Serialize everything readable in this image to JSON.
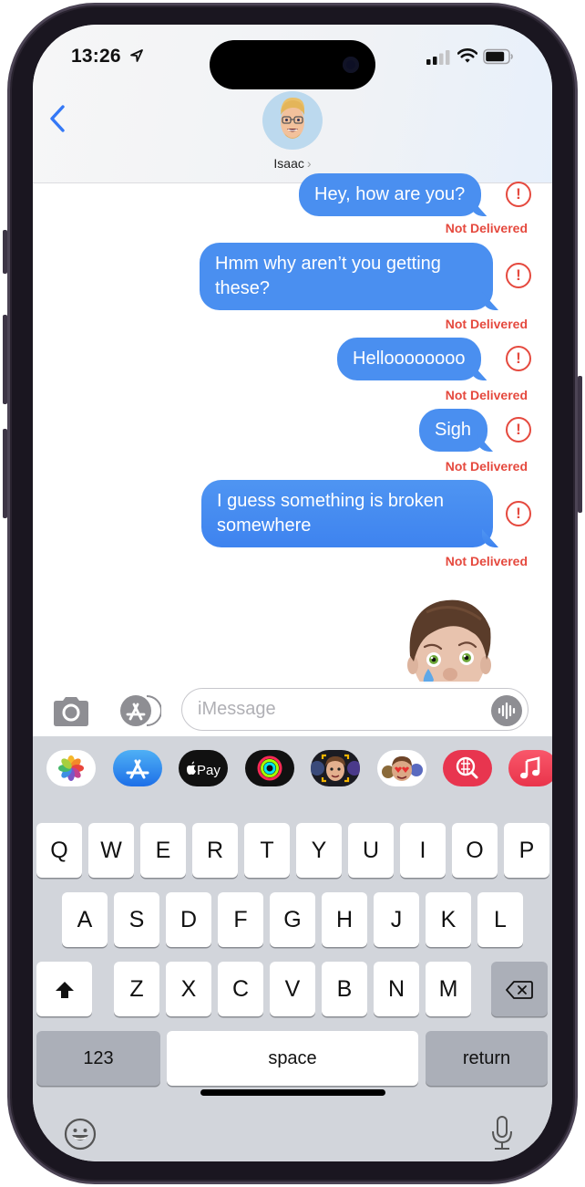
{
  "status_bar": {
    "time": "13:26",
    "location_icon": "location-arrow-icon",
    "signal_icon": "cellular-signal-icon",
    "wifi_icon": "wifi-icon",
    "battery_icon": "battery-icon"
  },
  "header": {
    "back_icon": "chevron-left-icon",
    "contact_name": "Isaac",
    "contact_chevron": "›",
    "avatar": "memoji-avatar"
  },
  "messages": [
    {
      "text": "Hey, how are you?",
      "status": "Not Delivered",
      "error_glyph": "!"
    },
    {
      "text_lines": [
        "Hmm why aren’t you getting",
        "these?"
      ],
      "status": "Not Delivered",
      "error_glyph": "!"
    },
    {
      "text": "Helloooooooo",
      "status": "Not Delivered",
      "error_glyph": "!"
    },
    {
      "text": "Sigh",
      "status": "Not Delivered",
      "error_glyph": "!"
    },
    {
      "text_lines": [
        "I guess something is broken",
        "somewhere"
      ],
      "status": "Not Delivered",
      "error_glyph": "!"
    }
  ],
  "sticker": "crying-memoji-sticker",
  "input_bar": {
    "camera_icon": "camera-icon",
    "apps_icon": "app-store-icon",
    "placeholder": "iMessage",
    "value": "",
    "audio_icon": "audio-waveform-icon"
  },
  "app_drawer": [
    {
      "name": "Photos",
      "icon": "photos-icon"
    },
    {
      "name": "App Store",
      "icon": "app-store-icon"
    },
    {
      "name": "Apple Pay",
      "label": "Pay",
      "icon": "apple-pay-icon"
    },
    {
      "name": "Activity",
      "icon": "activity-rings-icon"
    },
    {
      "name": "Memoji",
      "icon": "memoji-icon"
    },
    {
      "name": "Memoji Stickers",
      "icon": "memoji-stickers-icon"
    },
    {
      "name": "Images Search",
      "icon": "globe-search-icon"
    },
    {
      "name": "Music",
      "icon": "music-note-icon"
    }
  ],
  "keyboard": {
    "row1": [
      "Q",
      "W",
      "E",
      "R",
      "T",
      "Y",
      "U",
      "I",
      "O",
      "P"
    ],
    "row2": [
      "A",
      "S",
      "D",
      "F",
      "G",
      "H",
      "J",
      "K",
      "L"
    ],
    "row3": [
      "Z",
      "X",
      "C",
      "V",
      "B",
      "N",
      "M"
    ],
    "shift_icon": "shift-icon",
    "delete_icon": "delete-backspace-icon",
    "numbers_label": "123",
    "space_label": "space",
    "return_label": "return",
    "emoji_icon": "emoji-icon",
    "dictation_icon": "microphone-icon"
  },
  "colors": {
    "bubble_blue": "#4a8ff0",
    "error_red": "#e5493e",
    "link_blue": "#3478f6",
    "keyboard_bg": "#d2d5db"
  }
}
